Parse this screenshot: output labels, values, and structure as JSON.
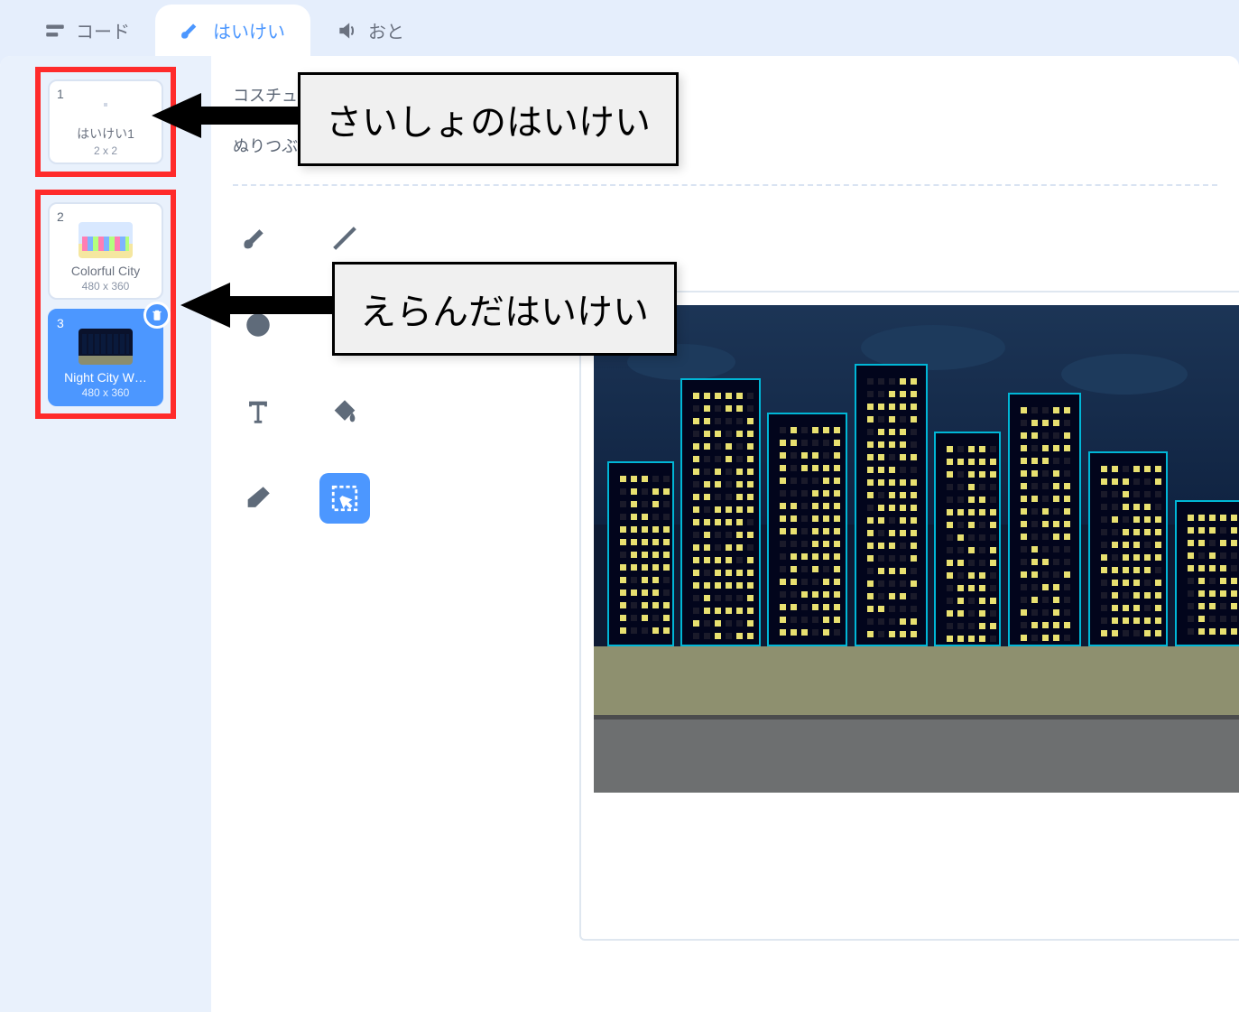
{
  "tabs": {
    "code": "コード",
    "backdrops": "はいけい",
    "sounds": "おと"
  },
  "sidebar": {
    "items": [
      {
        "num": "1",
        "label": "はいけい1",
        "size": "2 x 2"
      },
      {
        "num": "2",
        "label": "Colorful City",
        "size": "480 x 360"
      },
      {
        "num": "3",
        "label": "Night City W…",
        "size": "480 x 360"
      }
    ]
  },
  "editor": {
    "costume_label": "コスチュー",
    "fill_label": "ぬりつぶし"
  },
  "annotations": {
    "first": "さいしょのはいけい",
    "chosen": "えらんだはいけい"
  }
}
